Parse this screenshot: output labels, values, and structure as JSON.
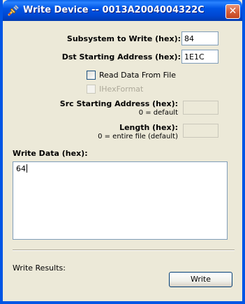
{
  "window": {
    "title": "Write Device -- 0013A2004004322C",
    "close_glyph": "✕",
    "icon": "connector-plug-icon"
  },
  "form": {
    "subsystem_label": "Subsystem to Write (hex):",
    "subsystem_value": "84",
    "dst_label": "Dst Starting Address (hex):",
    "dst_value": "1E1C",
    "read_from_file_label": "Read Data From File",
    "read_from_file_checked": false,
    "ihex_label": "IHexFormat",
    "ihex_checked": false,
    "src_label": "Src Starting Address (hex):",
    "src_hint": "0 = default",
    "src_value": "",
    "length_label": "Length (hex):",
    "length_hint": "0 = entire file (default)",
    "length_value": ""
  },
  "write_data": {
    "label": "Write Data (hex):",
    "value": "64"
  },
  "results": {
    "label": "Write Results:"
  },
  "actions": {
    "write_label": "Write"
  },
  "colors": {
    "titlebar": "#0055e5",
    "dialog_bg": "#ece9d8",
    "close_button": "#d7603c",
    "field_border": "#7f9db9"
  }
}
